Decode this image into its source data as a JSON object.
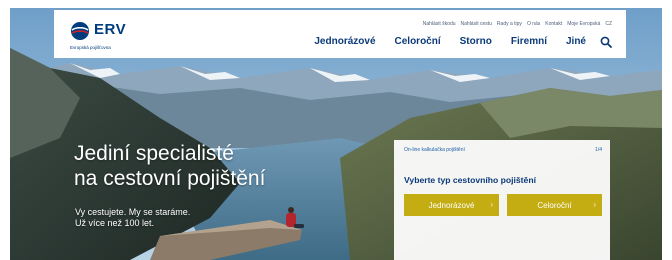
{
  "brand": {
    "name": "ERV",
    "tagline": "Evropská pojišťovna"
  },
  "header": {
    "utility_nav": [
      "Nahlásit škodu",
      "Nahlásit cestu",
      "Rady a tipy",
      "O nás",
      "Kontakt",
      "Moje Evropská",
      "CZ"
    ],
    "main_nav": [
      "Jednorázové",
      "Celoroční",
      "Storno",
      "Firemní",
      "Jiné"
    ],
    "search_icon": "search-icon"
  },
  "hero": {
    "title_line1": "Jediní specialisté",
    "title_line2": "na cestovní pojištění",
    "sub_line1": "Vy cestujete. My se staráme.",
    "sub_line2": "Už více než 100 let."
  },
  "calculator": {
    "label": "On-line kalkulačka pojištění",
    "step": "1/4",
    "title": "Vyberte typ cestovního pojištění",
    "options": [
      "Jednorázové",
      "Celoroční"
    ]
  },
  "colors": {
    "brand_blue": "#0c3a79",
    "accent_yellow": "#c3ad12"
  }
}
